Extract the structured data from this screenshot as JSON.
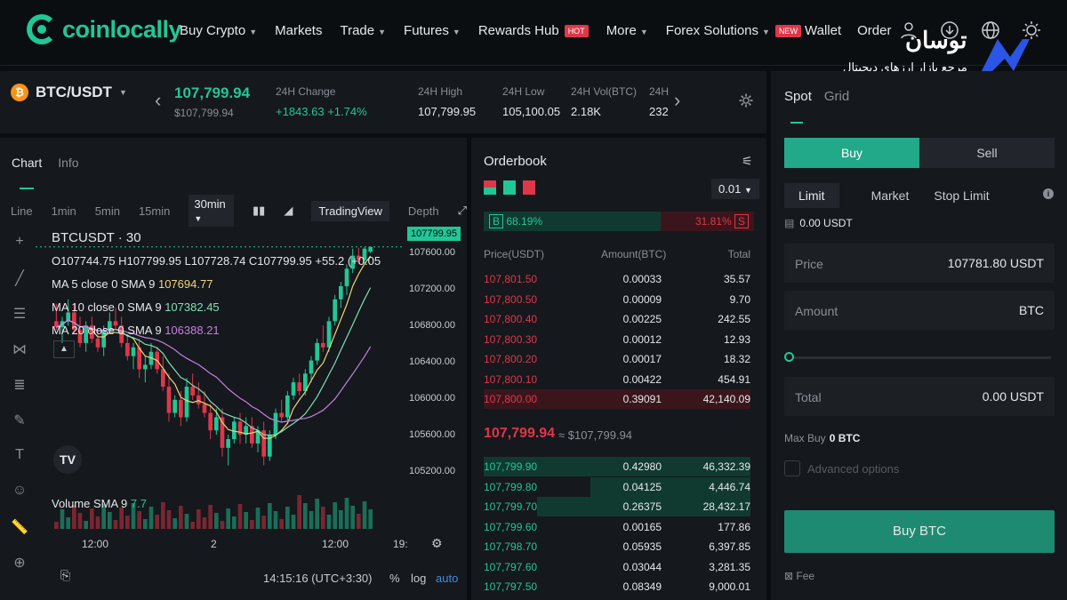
{
  "brand": {
    "name": "coinlocally"
  },
  "nav": {
    "items": [
      {
        "label": "Buy Crypto",
        "caret": true,
        "badge": ""
      },
      {
        "label": "Markets",
        "caret": false,
        "badge": ""
      },
      {
        "label": "Trade",
        "caret": true,
        "badge": ""
      },
      {
        "label": "Futures",
        "caret": true,
        "badge": ""
      },
      {
        "label": "Rewards Hub",
        "caret": false,
        "badge": "HOT"
      },
      {
        "label": "More",
        "caret": true,
        "badge": ""
      },
      {
        "label": "Forex Solutions",
        "caret": true,
        "badge": "NEW"
      }
    ],
    "wallet": "Wallet",
    "order": "Order"
  },
  "watermark": {
    "title": "توسان",
    "subtitle": "مرجع بازار ارزهای دیجیتال"
  },
  "ticker": {
    "pair": "BTC/USDT",
    "last_price": "107,799.94",
    "last_price_usd": "$107,799.94",
    "stats": [
      {
        "label": "24H Change",
        "value": "+1843.63  +1.74%",
        "green": true
      },
      {
        "label": "24H High",
        "value": "107,799.95",
        "green": false
      },
      {
        "label": "24H Low",
        "value": "105,100.05",
        "green": false
      },
      {
        "label": "24H Vol(BTC)",
        "value": "2.18K",
        "green": false
      },
      {
        "label": "24H",
        "value": "232.",
        "green": false
      }
    ]
  },
  "chart": {
    "tabs": [
      "Chart",
      "Info"
    ],
    "timeframes": [
      "Line",
      "1min",
      "5min",
      "15min",
      "30min"
    ],
    "tradingview": "TradingView",
    "depth": "Depth",
    "symbol": "BTCUSDT · 30",
    "ohlc": "O107744.75  H107799.95  L107728.74  C107799.95  +55.2 (+0.05",
    "ma5": {
      "label": "MA 5 close 0 SMA 9",
      "value": "107694.77"
    },
    "ma10": {
      "label": "MA 10 close 0 SMA 9",
      "value": "107382.45"
    },
    "ma20": {
      "label": "MA 20 close 0 SMA 9",
      "value": "106388.21"
    },
    "volume": {
      "label": "Volume SMA 9",
      "value": "7.7"
    },
    "current_tag": "107799.95",
    "time": "14:15:16 (UTC+3:30)",
    "pct": "%",
    "log": "log",
    "auto": "auto"
  },
  "chart_data": {
    "type": "candlestick",
    "y_ticks": [
      "107600.00",
      "107200.00",
      "106800.00",
      "106400.00",
      "106000.00",
      "105600.00",
      "105200.00"
    ],
    "x_ticks": [
      "12:00",
      "2",
      "12:00",
      "19:"
    ],
    "ylim": [
      105000,
      107950
    ],
    "candles": [
      [
        106950,
        107150,
        106850,
        106880
      ],
      [
        106880,
        107000,
        106700,
        106950
      ],
      [
        106950,
        107200,
        106900,
        107050
      ],
      [
        107050,
        107150,
        106800,
        106850
      ],
      [
        106850,
        107000,
        106650,
        106700
      ],
      [
        106700,
        106950,
        106600,
        106900
      ],
      [
        106900,
        107000,
        106700,
        106750
      ],
      [
        106750,
        106850,
        106600,
        106650
      ],
      [
        106650,
        106900,
        106550,
        106850
      ],
      [
        106850,
        107050,
        106800,
        106950
      ],
      [
        106950,
        107100,
        106850,
        106900
      ],
      [
        106900,
        107000,
        106650,
        106700
      ],
      [
        106700,
        106800,
        106500,
        106550
      ],
      [
        106550,
        106700,
        106400,
        106650
      ],
      [
        106650,
        106750,
        106300,
        106400
      ],
      [
        106400,
        106550,
        106250,
        106450
      ],
      [
        106450,
        106700,
        106400,
        106600
      ],
      [
        106600,
        106650,
        106350,
        106400
      ],
      [
        106400,
        106550,
        106150,
        106200
      ],
      [
        106200,
        106350,
        105800,
        105900
      ],
      [
        105900,
        106100,
        105850,
        106050
      ],
      [
        106050,
        106150,
        105750,
        105850
      ],
      [
        105850,
        106300,
        105800,
        106200
      ],
      [
        106200,
        106350,
        106050,
        106100
      ],
      [
        106100,
        106250,
        105950,
        106000
      ],
      [
        106000,
        106150,
        105850,
        105900
      ],
      [
        105900,
        106000,
        105600,
        105700
      ],
      [
        105700,
        105950,
        105650,
        105850
      ],
      [
        105850,
        105950,
        105400,
        105500
      ],
      [
        105500,
        105650,
        105300,
        105600
      ],
      [
        105600,
        105850,
        105550,
        105800
      ],
      [
        105800,
        105900,
        105550,
        105650
      ],
      [
        105650,
        105850,
        105550,
        105750
      ],
      [
        105750,
        105850,
        105500,
        105550
      ],
      [
        105550,
        105750,
        105450,
        105700
      ],
      [
        105700,
        105800,
        105300,
        105400
      ],
      [
        105400,
        105700,
        105350,
        105650
      ],
      [
        105650,
        105950,
        105600,
        105900
      ],
      [
        105900,
        106050,
        105800,
        105850
      ],
      [
        105850,
        106150,
        105800,
        106100
      ],
      [
        106100,
        106300,
        106050,
        106250
      ],
      [
        106250,
        106350,
        106100,
        106150
      ],
      [
        106150,
        106400,
        106100,
        106350
      ],
      [
        106350,
        106550,
        106250,
        106500
      ],
      [
        106500,
        106750,
        106450,
        106700
      ],
      [
        106700,
        106900,
        106600,
        106650
      ],
      [
        106650,
        107000,
        106600,
        106950
      ],
      [
        106950,
        107250,
        106900,
        107200
      ],
      [
        107200,
        107400,
        107100,
        107350
      ],
      [
        107350,
        107600,
        107250,
        107550
      ],
      [
        107550,
        107780,
        107500,
        107700
      ],
      [
        107700,
        107790,
        107600,
        107650
      ],
      [
        107650,
        107800,
        107600,
        107780
      ],
      [
        107744.75,
        107799.95,
        107728.74,
        107799.95
      ]
    ]
  },
  "orderbook": {
    "title": "Orderbook",
    "precision": "0.01",
    "buy_ratio": "68.19%",
    "sell_ratio": "31.81%",
    "buy_letter": "B",
    "sell_letter": "S",
    "headers": {
      "price": "Price(USDT)",
      "amount": "Amount(BTC)",
      "total": "Total"
    },
    "asks": [
      {
        "price": "107,801.50",
        "amount": "0.00033",
        "total": "35.57"
      },
      {
        "price": "107,800.50",
        "amount": "0.00009",
        "total": "9.70"
      },
      {
        "price": "107,800.40",
        "amount": "0.00225",
        "total": "242.55"
      },
      {
        "price": "107,800.30",
        "amount": "0.00012",
        "total": "12.93"
      },
      {
        "price": "107,800.20",
        "amount": "0.00017",
        "total": "18.32"
      },
      {
        "price": "107,800.10",
        "amount": "0.00422",
        "total": "454.91"
      },
      {
        "price": "107,800.00",
        "amount": "0.39091",
        "total": "42,140.09"
      }
    ],
    "mid_price": "107,799.94",
    "mid_usd": "≈ $107,799.94",
    "bids": [
      {
        "price": "107,799.90",
        "amount": "0.42980",
        "total": "46,332.39"
      },
      {
        "price": "107,799.80",
        "amount": "0.04125",
        "total": "4,446.74"
      },
      {
        "price": "107,799.70",
        "amount": "0.26375",
        "total": "28,432.17"
      },
      {
        "price": "107,799.60",
        "amount": "0.00165",
        "total": "177.86"
      },
      {
        "price": "107,798.70",
        "amount": "0.05935",
        "total": "6,397.85"
      },
      {
        "price": "107,797.60",
        "amount": "0.03044",
        "total": "3,281.35"
      },
      {
        "price": "107,797.50",
        "amount": "0.08349",
        "total": "9,000.01"
      }
    ]
  },
  "trade": {
    "tabs": [
      "Spot",
      "Grid"
    ],
    "buy": "Buy",
    "sell": "Sell",
    "order_types": [
      "Limit",
      "Market",
      "Stop Limit"
    ],
    "available": "0.00 USDT",
    "price_label": "Price",
    "price_value": "107781.80",
    "price_unit": "USDT",
    "amount_label": "Amount",
    "amount_unit": "BTC",
    "total_label": "Total",
    "total_value": "0.00",
    "total_unit": "USDT",
    "max_buy_label": "Max Buy",
    "max_buy_value": "0 BTC",
    "advanced": "Advanced options",
    "buy_button": "Buy BTC",
    "fee": "Fee"
  },
  "colors": {
    "accent": "#21c796",
    "down": "#e0364a",
    "bg": "#0b0e11",
    "panel": "#15181c"
  }
}
